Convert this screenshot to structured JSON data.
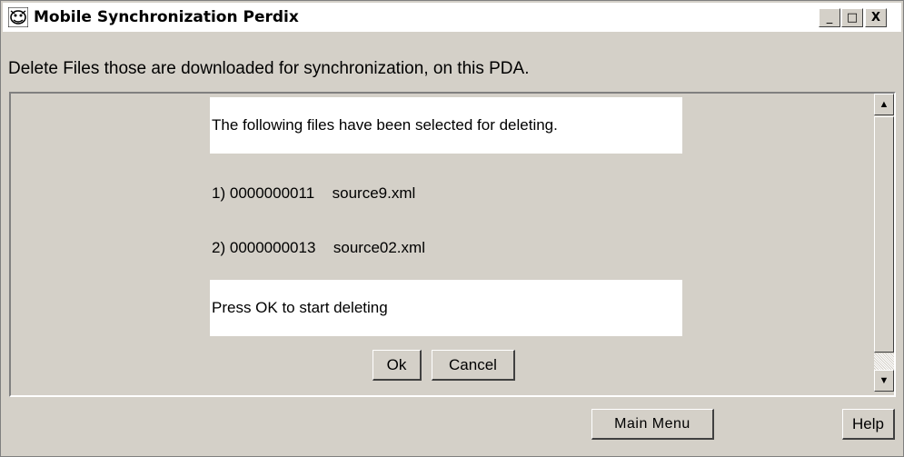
{
  "window": {
    "title": "Mobile Synchronization Perdix",
    "minimize_label": "_",
    "maximize_label": "□",
    "close_label": "X"
  },
  "subtitle": "Delete Files those are downloaded for synchronization, on this PDA.",
  "dialog": {
    "selected_message": "The following files have been selected for deleting.",
    "files": [
      {
        "index": "1)",
        "id": "0000000011",
        "name": "source9.xml"
      },
      {
        "index": "2)",
        "id": "0000000013",
        "name": "source02.xml"
      }
    ],
    "prompt": "Press OK to start deleting",
    "ok_label": "Ok",
    "cancel_label": "Cancel"
  },
  "scrollbar": {
    "up_arrow": "▲",
    "down_arrow": "▼"
  },
  "footer": {
    "main_menu_label": "Main Menu",
    "help_label": "Help"
  }
}
